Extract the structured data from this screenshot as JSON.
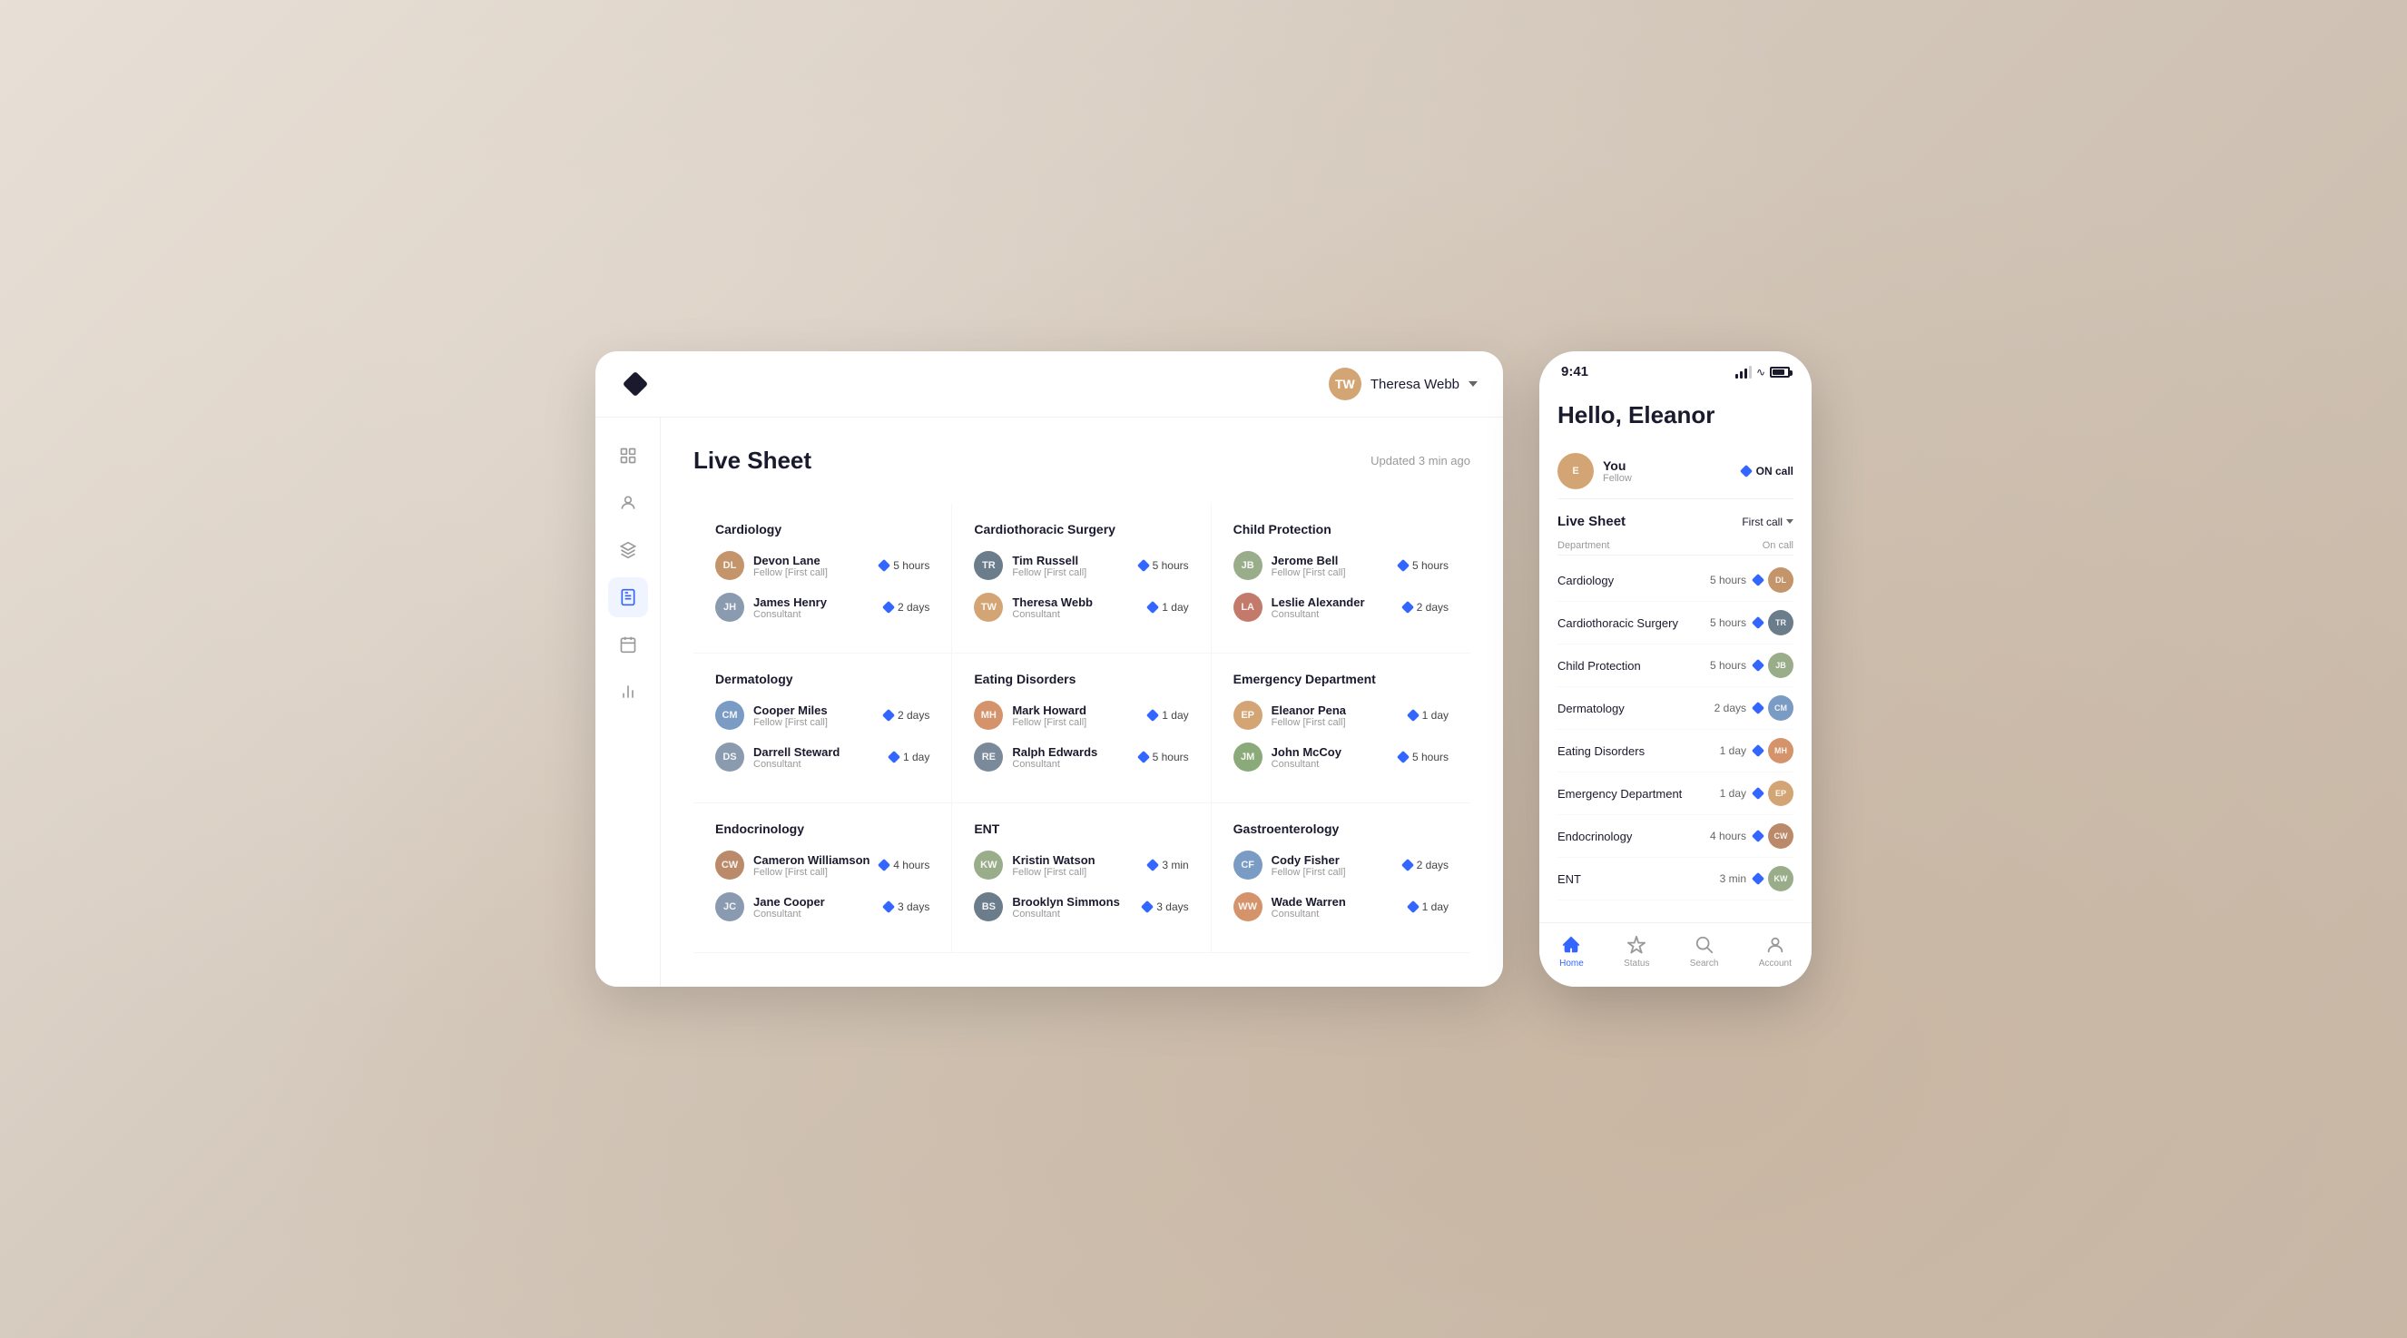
{
  "app": {
    "logo_label": "Logo",
    "user_name": "Theresa Webb",
    "updated_text": "Updated 3 min ago"
  },
  "sidebar": {
    "items": [
      {
        "id": "grid",
        "icon": "grid-icon",
        "active": false
      },
      {
        "id": "person",
        "icon": "person-icon",
        "active": false
      },
      {
        "id": "layers",
        "icon": "layers-icon",
        "active": false
      },
      {
        "id": "document",
        "icon": "document-icon",
        "active": true
      },
      {
        "id": "calendar",
        "icon": "calendar-icon",
        "active": false
      },
      {
        "id": "chart",
        "icon": "chart-icon",
        "active": false
      }
    ]
  },
  "desktop": {
    "page_title": "Live Sheet",
    "departments": [
      {
        "name": "Cardiology",
        "people": [
          {
            "name": "Devon Lane",
            "role": "Fellow [First call]",
            "time": "5 hours",
            "initials": "DL",
            "color": "av-brown"
          },
          {
            "name": "James Henry",
            "role": "Consultant",
            "time": "2 days",
            "initials": "JH",
            "color": "av-gray"
          }
        ]
      },
      {
        "name": "Cardiothoracic Surgery",
        "people": [
          {
            "name": "Tim Russell",
            "role": "Fellow [First call]",
            "time": "5 hours",
            "initials": "TR",
            "color": "av-dark"
          },
          {
            "name": "Theresa Webb",
            "role": "Consultant",
            "time": "1 day",
            "initials": "TW",
            "color": "av-tan"
          }
        ]
      },
      {
        "name": "Child Protection",
        "people": [
          {
            "name": "Jerome Bell",
            "role": "Fellow [First call]",
            "time": "5 hours",
            "initials": "JB",
            "color": "av-olive"
          },
          {
            "name": "Leslie Alexander",
            "role": "Consultant",
            "time": "2 days",
            "initials": "LA",
            "color": "av-red"
          }
        ]
      },
      {
        "name": "Dermatology",
        "people": [
          {
            "name": "Cooper Miles",
            "role": "Fellow [First call]",
            "time": "2 days",
            "initials": "CM",
            "color": "av-blue"
          },
          {
            "name": "Darrell Steward",
            "role": "Consultant",
            "time": "1 day",
            "initials": "DS",
            "color": "av-gray"
          }
        ]
      },
      {
        "name": "Eating Disorders",
        "people": [
          {
            "name": "Mark Howard",
            "role": "Fellow [First call]",
            "time": "1 day",
            "initials": "MH",
            "color": "av-peach"
          },
          {
            "name": "Ralph Edwards",
            "role": "Consultant",
            "time": "5 hours",
            "initials": "RE",
            "color": "av-slate"
          }
        ]
      },
      {
        "name": "Emergency Department",
        "people": [
          {
            "name": "Eleanor Pena",
            "role": "Fellow [First call]",
            "time": "1 day",
            "initials": "EP",
            "color": "av-tan"
          },
          {
            "name": "John McCoy",
            "role": "Consultant",
            "time": "5 hours",
            "initials": "JM",
            "color": "av-green"
          }
        ]
      },
      {
        "name": "Endocrinology",
        "people": [
          {
            "name": "Cameron Williamson",
            "role": "Fellow [First call]",
            "time": "4 hours",
            "initials": "CW",
            "color": "av-warm"
          },
          {
            "name": "Jane Cooper",
            "role": "Consultant",
            "time": "3 days",
            "initials": "JC",
            "color": "av-cool"
          }
        ]
      },
      {
        "name": "ENT",
        "people": [
          {
            "name": "Kristin Watson",
            "role": "Fellow [First call]",
            "time": "3 min",
            "initials": "KW",
            "color": "av-olive"
          },
          {
            "name": "Brooklyn Simmons",
            "role": "Consultant",
            "time": "3 days",
            "initials": "BS",
            "color": "av-dark"
          }
        ]
      },
      {
        "name": "Gastroenterology",
        "people": [
          {
            "name": "Cody Fisher",
            "role": "Fellow [First call]",
            "time": "2 days",
            "initials": "CF",
            "color": "av-blue"
          },
          {
            "name": "Wade Warren",
            "role": "Consultant",
            "time": "1 day",
            "initials": "WW",
            "color": "av-peach"
          }
        ]
      }
    ]
  },
  "mobile": {
    "status_time": "9:41",
    "greeting": "Hello, Eleanor",
    "you": {
      "name": "You",
      "role": "Fellow",
      "on_call_label": "ON call"
    },
    "live_sheet_title": "Live Sheet",
    "first_call_label": "First call",
    "col_dept": "Department",
    "col_call": "On call",
    "mobile_depts": [
      {
        "name": "Cardiology",
        "hours": "5 hours",
        "color": "av-brown",
        "initials": "DL"
      },
      {
        "name": "Cardiothoracic Surgery",
        "hours": "5 hours",
        "color": "av-dark",
        "initials": "TR"
      },
      {
        "name": "Child Protection",
        "hours": "5 hours",
        "color": "av-olive",
        "initials": "JB"
      },
      {
        "name": "Dermatology",
        "hours": "2 days",
        "color": "av-blue",
        "initials": "CM"
      },
      {
        "name": "Eating Disorders",
        "hours": "1 day",
        "color": "av-peach",
        "initials": "MH"
      },
      {
        "name": "Emergency Department",
        "hours": "1 day",
        "color": "av-tan",
        "initials": "EP"
      },
      {
        "name": "Endocrinology",
        "hours": "4 hours",
        "color": "av-warm",
        "initials": "CW"
      },
      {
        "name": "ENT",
        "hours": "3 min",
        "color": "av-olive",
        "initials": "KW"
      }
    ],
    "nav": [
      {
        "id": "home",
        "label": "Home",
        "active": true
      },
      {
        "id": "status",
        "label": "Status",
        "active": false
      },
      {
        "id": "search",
        "label": "Search",
        "active": false
      },
      {
        "id": "account",
        "label": "Account",
        "active": false
      }
    ]
  }
}
